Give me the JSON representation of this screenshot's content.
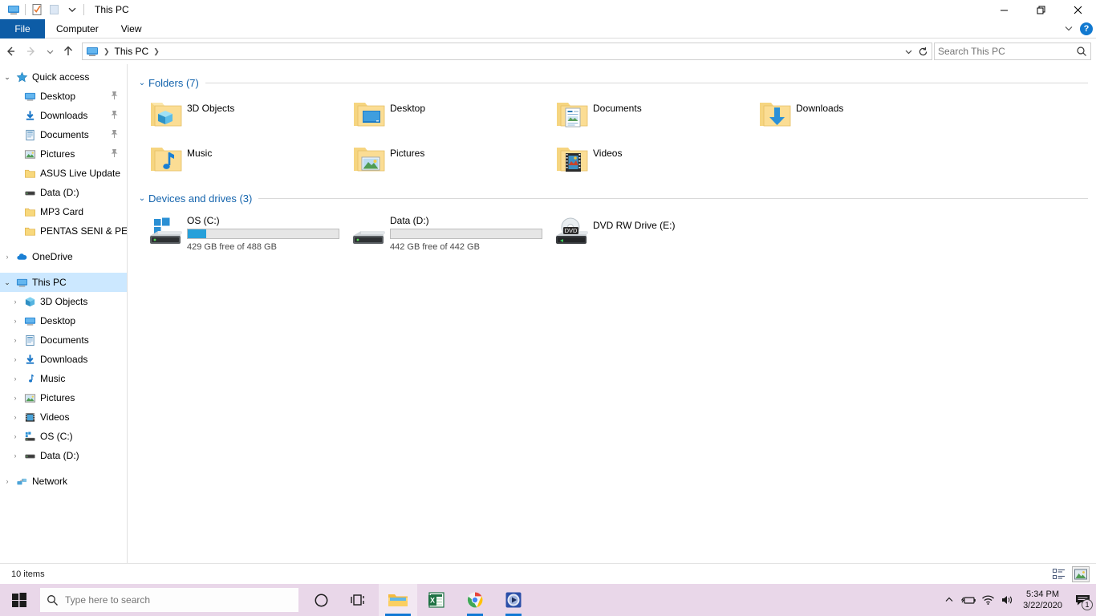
{
  "window": {
    "title": "This PC",
    "quick_access_toolbar": [
      {
        "name": "this-pc-icon",
        "label": "This PC"
      },
      {
        "name": "properties-icon",
        "label": "Properties"
      },
      {
        "name": "new-folder-icon",
        "label": "New folder"
      },
      {
        "name": "customize-dropdown-icon",
        "label": "Customize Quick Access Toolbar"
      }
    ],
    "controls": {
      "minimize": "—",
      "restore": "❐",
      "close": "✕"
    }
  },
  "ribbon": {
    "tabs": [
      {
        "label": "File",
        "active": true
      },
      {
        "label": "Computer",
        "active": false
      },
      {
        "label": "View",
        "active": false
      }
    ],
    "expand_label": "⌄",
    "help_label": "?"
  },
  "navigation": {
    "back": "←",
    "forward": "→",
    "recent": "⌄",
    "up": "↑",
    "breadcrumb": [
      "This PC"
    ],
    "address_dropdown": "⌄",
    "refresh": "↻"
  },
  "search": {
    "placeholder": "Search This PC",
    "value": "",
    "icon": "search-icon"
  },
  "sidebar": {
    "groups": [
      {
        "name": "quick-access",
        "label": "Quick access",
        "icon": "star-icon",
        "expanded": true,
        "chevron": "⌄",
        "items": [
          {
            "label": "Desktop",
            "icon": "desktop-icon",
            "pinned": true
          },
          {
            "label": "Downloads",
            "icon": "downloads-icon",
            "pinned": true
          },
          {
            "label": "Documents",
            "icon": "documents-icon",
            "pinned": true
          },
          {
            "label": "Pictures",
            "icon": "pictures-icon",
            "pinned": true
          },
          {
            "label": "ASUS Live Update",
            "icon": "folder-icon",
            "pinned": false
          },
          {
            "label": "Data (D:)",
            "icon": "drive-icon",
            "pinned": false
          },
          {
            "label": "MP3 Card",
            "icon": "folder-icon",
            "pinned": false
          },
          {
            "label": "PENTAS SENI & PER",
            "icon": "folder-icon",
            "pinned": false
          }
        ]
      },
      {
        "name": "onedrive",
        "label": "OneDrive",
        "icon": "cloud-icon",
        "expanded": false,
        "chevron": "›",
        "items": []
      },
      {
        "name": "this-pc",
        "label": "This PC",
        "icon": "this-pc-icon",
        "expanded": true,
        "selected": true,
        "chevron": "⌄",
        "items": [
          {
            "label": "3D Objects",
            "icon": "3d-objects-icon",
            "chevron": "›"
          },
          {
            "label": "Desktop",
            "icon": "desktop-icon",
            "chevron": "›"
          },
          {
            "label": "Documents",
            "icon": "documents-icon",
            "chevron": "›"
          },
          {
            "label": "Downloads",
            "icon": "downloads-icon",
            "chevron": "›"
          },
          {
            "label": "Music",
            "icon": "music-icon",
            "chevron": "›"
          },
          {
            "label": "Pictures",
            "icon": "pictures-icon",
            "chevron": "›"
          },
          {
            "label": "Videos",
            "icon": "videos-icon",
            "chevron": "›"
          },
          {
            "label": "OS (C:)",
            "icon": "windows-drive-icon",
            "chevron": "›"
          },
          {
            "label": "Data (D:)",
            "icon": "drive-icon",
            "chevron": "›"
          }
        ]
      },
      {
        "name": "network",
        "label": "Network",
        "icon": "network-icon",
        "expanded": false,
        "chevron": "›",
        "items": []
      }
    ]
  },
  "content": {
    "folders_group": {
      "title": "Folders (7)",
      "chevron": "⌄",
      "items": [
        {
          "label": "3D Objects",
          "icon": "folder-3d-objects-icon"
        },
        {
          "label": "Desktop",
          "icon": "folder-desktop-icon"
        },
        {
          "label": "Documents",
          "icon": "folder-documents-icon"
        },
        {
          "label": "Downloads",
          "icon": "folder-downloads-icon"
        },
        {
          "label": "Music",
          "icon": "folder-music-icon"
        },
        {
          "label": "Pictures",
          "icon": "folder-pictures-icon"
        },
        {
          "label": "Videos",
          "icon": "folder-videos-icon"
        }
      ]
    },
    "drives_group": {
      "title": "Devices and drives (3)",
      "chevron": "⌄",
      "items": [
        {
          "label": "OS (C:)",
          "icon": "windows-drive-icon",
          "free_text": "429 GB free of 488 GB",
          "used_percent": 12,
          "bar_color": "#26a0da",
          "has_bar": true
        },
        {
          "label": "Data (D:)",
          "icon": "drive-icon",
          "free_text": "442 GB free of 442 GB",
          "used_percent": 0,
          "bar_color": "#26a0da",
          "has_bar": true
        },
        {
          "label": "DVD RW Drive (E:)",
          "icon": "dvd-drive-icon",
          "free_text": "",
          "used_percent": 0,
          "has_bar": false
        }
      ]
    }
  },
  "statusbar": {
    "item_count": "10 items",
    "views": [
      {
        "name": "details-view-button",
        "label": "Details view",
        "active": false
      },
      {
        "name": "large-icons-view-button",
        "label": "Large icons view",
        "active": true
      }
    ]
  },
  "taskbar": {
    "start_label": "Start",
    "search_placeholder": "Type here to search",
    "search_value": "",
    "apps": [
      {
        "name": "cortana-icon",
        "label": "Cortana",
        "state": "idle"
      },
      {
        "name": "task-view-icon",
        "label": "Task View",
        "state": "idle"
      },
      {
        "name": "file-explorer-icon",
        "label": "File Explorer",
        "state": "active"
      },
      {
        "name": "excel-icon",
        "label": "Excel",
        "state": "idle"
      },
      {
        "name": "chrome-icon",
        "label": "Google Chrome",
        "state": "running"
      },
      {
        "name": "media-player-icon",
        "label": "Media Player",
        "state": "running"
      }
    ],
    "tray": {
      "show_hidden": "∧",
      "icons": [
        {
          "name": "battery-icon",
          "label": "Battery"
        },
        {
          "name": "wifi-icon",
          "label": "Network"
        },
        {
          "name": "volume-icon",
          "label": "Volume"
        }
      ],
      "time": "5:34 PM",
      "date": "3/22/2020",
      "notification_count": "1"
    }
  },
  "colors": {
    "accent": "#0d5ca6",
    "group_header": "#1464ad",
    "selection": "#cce8ff",
    "drive_bar": "#26a0da",
    "taskbar": "#e9d7e9"
  }
}
